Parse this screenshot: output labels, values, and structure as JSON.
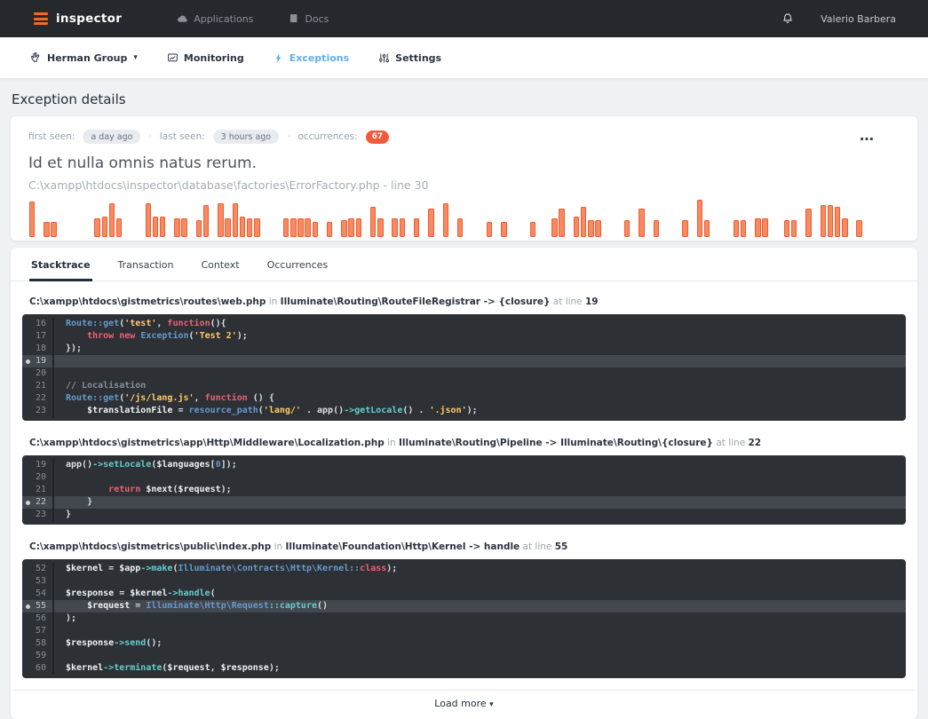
{
  "navbar": {
    "brand": "inspector",
    "items": [
      {
        "label": "Applications"
      },
      {
        "label": "Docs"
      }
    ],
    "user": "Valerio Barbera"
  },
  "subnav": {
    "items": [
      {
        "label": "Herman Group",
        "caret": "▾"
      },
      {
        "label": "Monitoring"
      },
      {
        "label": "Exceptions"
      },
      {
        "label": "Settings"
      }
    ]
  },
  "page": {
    "title": "Exception details"
  },
  "exception": {
    "meta": {
      "first_seen_label": "first seen:",
      "first_seen": "a day ago",
      "last_seen_label": "last seen:",
      "last_seen": "3 hours ago",
      "occurrences_label": "occurrences:",
      "occurrences": "67",
      "separator": "·"
    },
    "more_icon": "⋯",
    "title": "Id et nulla omnis natus rerum.",
    "location": "C:\\xampp\\htdocs\\inspector\\database\\factories\\ErrorFactory.php - line 30"
  },
  "chart_data": {
    "type": "bar",
    "title": "occurrences over time (sparkline, no axes shown)",
    "xlabel": "",
    "ylabel": "",
    "ylim": [
      0,
      1
    ],
    "bar_fill": "#f58a63",
    "bar_border": "#ef5c2e",
    "values": [
      0.95,
      0,
      0.4,
      0.4,
      0,
      0,
      0,
      0,
      0,
      0.5,
      0.55,
      0.9,
      0.5,
      0,
      0,
      0,
      0.9,
      0.55,
      0.55,
      0,
      0.5,
      0.5,
      0,
      0.45,
      0.85,
      0,
      0.9,
      0.5,
      0.9,
      0.55,
      0.5,
      0.5,
      0,
      0,
      0,
      0.5,
      0.5,
      0.5,
      0.5,
      0.4,
      0,
      0.4,
      0,
      0.45,
      0.5,
      0.5,
      0,
      0.8,
      0.5,
      0,
      0.5,
      0.5,
      0,
      0.5,
      0,
      0.75,
      0,
      0.9,
      0,
      0.5,
      0,
      0,
      0,
      0.4,
      0,
      0.4,
      0,
      0,
      0,
      0.4,
      0,
      0,
      0.5,
      0.75,
      0,
      0.55,
      0.8,
      0.45,
      0.45,
      0,
      0,
      0,
      0.45,
      0,
      0.75,
      0,
      0.45,
      0,
      0,
      0,
      0.45,
      0,
      1,
      0.45,
      0,
      0,
      0,
      0.45,
      0.45,
      0,
      0.5,
      0.5,
      0,
      0,
      0.45,
      0.45,
      0,
      0.75,
      0,
      0.85,
      0.85,
      0.8,
      0.5,
      0,
      0.45,
      0,
      0,
      0,
      0,
      0
    ]
  },
  "stacktrace": {
    "tabs": [
      {
        "label": "Stacktrace"
      },
      {
        "label": "Transaction"
      },
      {
        "label": "Context"
      },
      {
        "label": "Occurrences"
      }
    ],
    "in_label": "in",
    "at_label": "at line",
    "frames": [
      {
        "file": "C:\\xampp\\htdocs\\gistmetrics\\routes\\web.php",
        "classmethod": "Illuminate\\Routing\\RouteFileRegistrar -> {closure}",
        "line": "19",
        "lines": [
          {
            "n": "16",
            "seg": [
              [
                "cls",
                "Route::get"
              ],
              [
                "pln",
                "("
              ],
              [
                "str",
                "'test'"
              ],
              [
                "pln",
                ", "
              ],
              [
                "kw",
                "function"
              ],
              [
                "pln",
                "(){"
              ]
            ]
          },
          {
            "n": "17",
            "seg": [
              [
                "pln",
                "    "
              ],
              [
                "kw",
                "throw"
              ],
              [
                "pln",
                " "
              ],
              [
                "kw",
                "new"
              ],
              [
                "pln",
                " "
              ],
              [
                "cls",
                "Exception"
              ],
              [
                "pln",
                "("
              ],
              [
                "str",
                "'Test 2'"
              ],
              [
                "pln",
                ");"
              ]
            ]
          },
          {
            "n": "18",
            "seg": [
              [
                "pln",
                "});"
              ]
            ]
          },
          {
            "n": "19",
            "hl": true,
            "seg": []
          },
          {
            "n": "20",
            "seg": []
          },
          {
            "n": "21",
            "seg": [
              [
                "cmt",
                "// Localisation"
              ]
            ]
          },
          {
            "n": "22",
            "seg": [
              [
                "cls",
                "Route::get"
              ],
              [
                "pln",
                "("
              ],
              [
                "str",
                "'/js/lang.js'"
              ],
              [
                "pln",
                ", "
              ],
              [
                "kw",
                "function"
              ],
              [
                "pln",
                " () {"
              ]
            ]
          },
          {
            "n": "23",
            "seg": [
              [
                "pln",
                "    "
              ],
              [
                "var",
                "$translationFile"
              ],
              [
                "pln",
                " = "
              ],
              [
                "cls",
                "resource_path"
              ],
              [
                "pln",
                "("
              ],
              [
                "str",
                "'lang/'"
              ],
              [
                "pln",
                " . app()"
              ],
              [
                "fn",
                "->getLocale"
              ],
              [
                "pln",
                "() . "
              ],
              [
                "str",
                "'.json'"
              ],
              [
                "pln",
                ");"
              ]
            ]
          }
        ]
      },
      {
        "file": "C:\\xampp\\htdocs\\gistmetrics\\app\\Http\\Middleware\\Localization.php",
        "classmethod": "Illuminate\\Routing\\Pipeline -> Illuminate\\Routing\\{closure}",
        "line": "22",
        "lines": [
          {
            "n": "19",
            "seg": [
              [
                "pln",
                "app()"
              ],
              [
                "fn",
                "->setLocale"
              ],
              [
                "pln",
                "("
              ],
              [
                "var",
                "$languages"
              ],
              [
                "pln",
                "["
              ],
              [
                "num",
                "0"
              ],
              [
                "pln",
                "]);"
              ]
            ]
          },
          {
            "n": "20",
            "seg": []
          },
          {
            "n": "21",
            "seg": [
              [
                "pln",
                "        "
              ],
              [
                "kw",
                "return"
              ],
              [
                "pln",
                " "
              ],
              [
                "var",
                "$next"
              ],
              [
                "pln",
                "("
              ],
              [
                "var",
                "$request"
              ],
              [
                "pln",
                ");"
              ]
            ]
          },
          {
            "n": "22",
            "hl": true,
            "seg": [
              [
                "pln",
                "    }"
              ]
            ]
          },
          {
            "n": "23",
            "seg": [
              [
                "pln",
                "}"
              ]
            ]
          }
        ]
      },
      {
        "file": "C:\\xampp\\htdocs\\gistmetrics\\public\\index.php",
        "classmethod": "Illuminate\\Foundation\\Http\\Kernel -> handle",
        "line": "55",
        "lines": [
          {
            "n": "52",
            "seg": [
              [
                "var",
                "$kernel"
              ],
              [
                "pln",
                " = "
              ],
              [
                "var",
                "$app"
              ],
              [
                "fn",
                "->make"
              ],
              [
                "pln",
                "("
              ],
              [
                "cls",
                "Illuminate\\Contracts\\Http\\Kernel::"
              ],
              [
                "kw",
                "class"
              ],
              [
                "pln",
                ");"
              ]
            ]
          },
          {
            "n": "53",
            "seg": []
          },
          {
            "n": "54",
            "seg": [
              [
                "var",
                "$response"
              ],
              [
                "pln",
                " = "
              ],
              [
                "var",
                "$kernel"
              ],
              [
                "fn",
                "->handle"
              ],
              [
                "pln",
                "("
              ]
            ]
          },
          {
            "n": "55",
            "hl": true,
            "seg": [
              [
                "pln",
                "    "
              ],
              [
                "var",
                "$request"
              ],
              [
                "pln",
                " = "
              ],
              [
                "cls",
                "Illuminate\\Http\\Request"
              ],
              [
                "fn",
                "::capture"
              ],
              [
                "pln",
                "()"
              ]
            ]
          },
          {
            "n": "56",
            "seg": [
              [
                "pln",
                ");"
              ]
            ]
          },
          {
            "n": "57",
            "seg": []
          },
          {
            "n": "58",
            "seg": [
              [
                "var",
                "$response"
              ],
              [
                "fn",
                "->send"
              ],
              [
                "pln",
                "();"
              ]
            ]
          },
          {
            "n": "59",
            "seg": []
          },
          {
            "n": "60",
            "seg": [
              [
                "var",
                "$kernel"
              ],
              [
                "fn",
                "->terminate"
              ],
              [
                "pln",
                "("
              ],
              [
                "var",
                "$request"
              ],
              [
                "pln",
                ", "
              ],
              [
                "var",
                "$response"
              ],
              [
                "pln",
                ");"
              ]
            ]
          }
        ]
      }
    ],
    "load_more": {
      "label": "Load more",
      "caret": "▾"
    }
  }
}
